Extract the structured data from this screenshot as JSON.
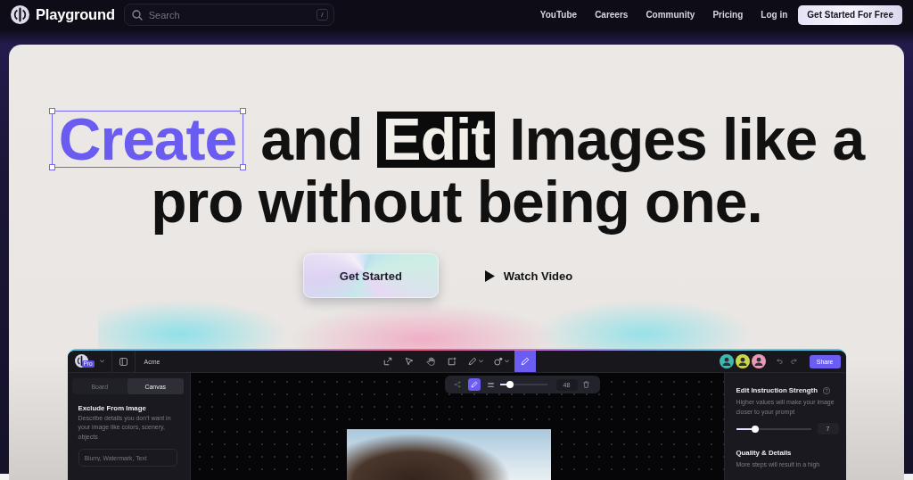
{
  "nav": {
    "brand": "Playground",
    "search": {
      "placeholder": "Search",
      "shortcut": "/"
    },
    "links": [
      {
        "label": "YouTube"
      },
      {
        "label": "Careers"
      },
      {
        "label": "Community"
      },
      {
        "label": "Pricing"
      },
      {
        "label": "Log in"
      }
    ],
    "cta": "Get Started For Free"
  },
  "hero": {
    "headline": {
      "lines": [
        [
          {
            "kind": "framed",
            "text": "Create"
          },
          {
            "kind": "plain",
            "text": "and"
          },
          {
            "kind": "inverted",
            "text": "Edit"
          },
          {
            "kind": "plain",
            "text": "Images like a"
          }
        ],
        [
          {
            "kind": "plain",
            "text": "pro without being one."
          }
        ]
      ]
    },
    "buttons": [
      {
        "kind": "primary",
        "label": "Get Started"
      },
      {
        "kind": "video",
        "label": "Watch Video"
      }
    ]
  },
  "app": {
    "badge": "Pro",
    "workspace": "Acme",
    "tools": [
      {
        "selected": false,
        "menu": false
      },
      {
        "selected": false,
        "menu": false
      },
      {
        "selected": false,
        "menu": false
      },
      {
        "selected": false,
        "menu": false
      },
      {
        "selected": false,
        "menu": true
      },
      {
        "selected": false,
        "menu": true
      },
      {
        "selected": true,
        "menu": false
      }
    ],
    "collaborators": [
      {
        "color": "#3fb8ae"
      },
      {
        "color": "#c9d64a"
      },
      {
        "color": "#e79ab5"
      }
    ],
    "share": "Share",
    "left_panel": {
      "tabs": [
        {
          "label": "Board",
          "selected": false
        },
        {
          "label": "Canvas",
          "selected": true
        }
      ],
      "title": "Exclude From Image",
      "description": "Describe details you don't want in your image like colors, scenery, objects",
      "input": {
        "placeholder": "Blurry, Watermark, Text"
      }
    },
    "canvas": {
      "brush_tools": [
        {
          "selected": false
        },
        {
          "selected": true
        }
      ],
      "brush": {
        "level": 0.17,
        "reading": "48"
      }
    },
    "right_panel": {
      "sections": [
        {
          "title": "Edit Instruction Strength",
          "help": true,
          "description": "Higher values will make your image closer to your prompt",
          "slider": {
            "level": 0.23,
            "reading": "7"
          }
        },
        {
          "title": "Quality & Details",
          "help": false,
          "description": "More steps will result in a high"
        }
      ]
    }
  }
}
